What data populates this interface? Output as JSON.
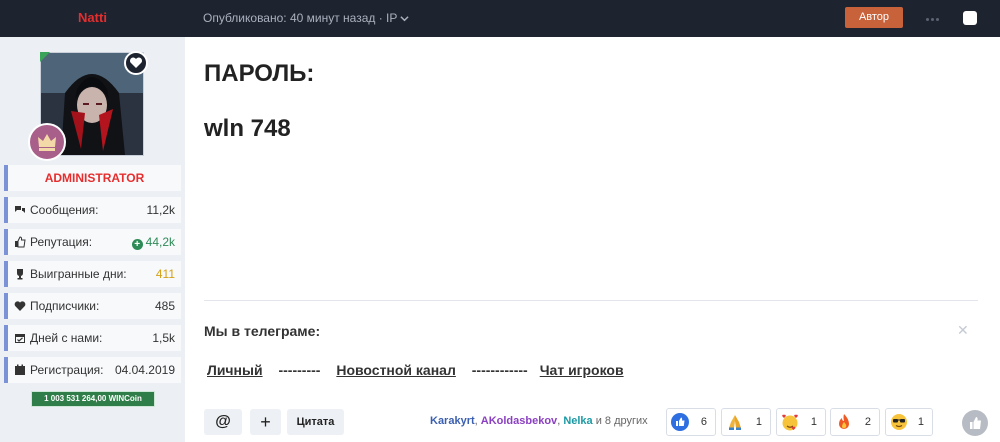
{
  "topbar": {
    "author_name": "Natti",
    "posted_text": "Опубликовано: 40 минут назад · IP",
    "author_badge": "Автор"
  },
  "sidebar": {
    "role": "ADMINISTRATOR",
    "stats": [
      {
        "label": "Сообщения:",
        "value": "11,2k",
        "icon": "comments-icon"
      },
      {
        "label": "Репутация:",
        "value": "44,2k",
        "icon": "thumbs-up-icon"
      },
      {
        "label": "Выигранные дни:",
        "value": "411",
        "icon": "trophy-icon"
      },
      {
        "label": "Подписчики:",
        "value": "485",
        "icon": "heart-icon"
      },
      {
        "label": "Дней с нами:",
        "value": "1,5k",
        "icon": "calendar-check-icon"
      },
      {
        "label": "Регистрация:",
        "value": "04.04.2019",
        "icon": "calendar-icon"
      }
    ],
    "coin_badge": "1 003 531 264,00 WINCoin"
  },
  "post": {
    "line1": "ПАРОЛЬ:",
    "line2": "wln 748"
  },
  "signature": {
    "title": "Мы в телеграме:",
    "close": "✕",
    "links": [
      {
        "label": "Личный"
      },
      {
        "separator": "---------"
      },
      {
        "label": "Новостной канал"
      },
      {
        "separator": "------------"
      },
      {
        "label": "Чат игроков"
      }
    ]
  },
  "actions": {
    "mention": "@",
    "plus": "+",
    "quote": "Цитата"
  },
  "reactors": {
    "user1": "Karakyrt",
    "sep1": ", ",
    "user2": "AKoldasbekov",
    "sep2": ", ",
    "user3": "Nelka",
    "rest": " и 8 других"
  },
  "reactions": [
    {
      "icon": "like-icon",
      "count": "6"
    },
    {
      "icon": "pray-icon",
      "count": "1"
    },
    {
      "icon": "smiling-hearts-icon",
      "count": "1"
    },
    {
      "icon": "fire-icon",
      "count": "2"
    },
    {
      "icon": "sunglasses-icon",
      "count": "1"
    }
  ],
  "colors": {
    "topbar_bg": "#1e2330",
    "author_name": "#e62e2e",
    "author_badge_bg": "#c8623a",
    "sidebar_bg": "#ecf0f5",
    "accent_border": "#7b93d6",
    "reputation_green": "#2e8b57",
    "days_won_gold": "#d4a017",
    "coin_badge_bg": "#2f7d48"
  }
}
